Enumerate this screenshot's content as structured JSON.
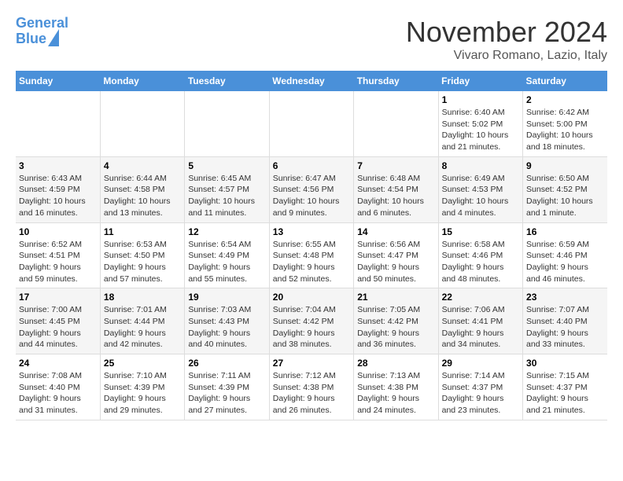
{
  "header": {
    "logo_line1": "General",
    "logo_line2": "Blue",
    "month_title": "November 2024",
    "location": "Vivaro Romano, Lazio, Italy"
  },
  "days_of_week": [
    "Sunday",
    "Monday",
    "Tuesday",
    "Wednesday",
    "Thursday",
    "Friday",
    "Saturday"
  ],
  "weeks": [
    [
      {
        "day": "",
        "info": ""
      },
      {
        "day": "",
        "info": ""
      },
      {
        "day": "",
        "info": ""
      },
      {
        "day": "",
        "info": ""
      },
      {
        "day": "",
        "info": ""
      },
      {
        "day": "1",
        "info": "Sunrise: 6:40 AM\nSunset: 5:02 PM\nDaylight: 10 hours and 21 minutes."
      },
      {
        "day": "2",
        "info": "Sunrise: 6:42 AM\nSunset: 5:00 PM\nDaylight: 10 hours and 18 minutes."
      }
    ],
    [
      {
        "day": "3",
        "info": "Sunrise: 6:43 AM\nSunset: 4:59 PM\nDaylight: 10 hours and 16 minutes."
      },
      {
        "day": "4",
        "info": "Sunrise: 6:44 AM\nSunset: 4:58 PM\nDaylight: 10 hours and 13 minutes."
      },
      {
        "day": "5",
        "info": "Sunrise: 6:45 AM\nSunset: 4:57 PM\nDaylight: 10 hours and 11 minutes."
      },
      {
        "day": "6",
        "info": "Sunrise: 6:47 AM\nSunset: 4:56 PM\nDaylight: 10 hours and 9 minutes."
      },
      {
        "day": "7",
        "info": "Sunrise: 6:48 AM\nSunset: 4:54 PM\nDaylight: 10 hours and 6 minutes."
      },
      {
        "day": "8",
        "info": "Sunrise: 6:49 AM\nSunset: 4:53 PM\nDaylight: 10 hours and 4 minutes."
      },
      {
        "day": "9",
        "info": "Sunrise: 6:50 AM\nSunset: 4:52 PM\nDaylight: 10 hours and 1 minute."
      }
    ],
    [
      {
        "day": "10",
        "info": "Sunrise: 6:52 AM\nSunset: 4:51 PM\nDaylight: 9 hours and 59 minutes."
      },
      {
        "day": "11",
        "info": "Sunrise: 6:53 AM\nSunset: 4:50 PM\nDaylight: 9 hours and 57 minutes."
      },
      {
        "day": "12",
        "info": "Sunrise: 6:54 AM\nSunset: 4:49 PM\nDaylight: 9 hours and 55 minutes."
      },
      {
        "day": "13",
        "info": "Sunrise: 6:55 AM\nSunset: 4:48 PM\nDaylight: 9 hours and 52 minutes."
      },
      {
        "day": "14",
        "info": "Sunrise: 6:56 AM\nSunset: 4:47 PM\nDaylight: 9 hours and 50 minutes."
      },
      {
        "day": "15",
        "info": "Sunrise: 6:58 AM\nSunset: 4:46 PM\nDaylight: 9 hours and 48 minutes."
      },
      {
        "day": "16",
        "info": "Sunrise: 6:59 AM\nSunset: 4:46 PM\nDaylight: 9 hours and 46 minutes."
      }
    ],
    [
      {
        "day": "17",
        "info": "Sunrise: 7:00 AM\nSunset: 4:45 PM\nDaylight: 9 hours and 44 minutes."
      },
      {
        "day": "18",
        "info": "Sunrise: 7:01 AM\nSunset: 4:44 PM\nDaylight: 9 hours and 42 minutes."
      },
      {
        "day": "19",
        "info": "Sunrise: 7:03 AM\nSunset: 4:43 PM\nDaylight: 9 hours and 40 minutes."
      },
      {
        "day": "20",
        "info": "Sunrise: 7:04 AM\nSunset: 4:42 PM\nDaylight: 9 hours and 38 minutes."
      },
      {
        "day": "21",
        "info": "Sunrise: 7:05 AM\nSunset: 4:42 PM\nDaylight: 9 hours and 36 minutes."
      },
      {
        "day": "22",
        "info": "Sunrise: 7:06 AM\nSunset: 4:41 PM\nDaylight: 9 hours and 34 minutes."
      },
      {
        "day": "23",
        "info": "Sunrise: 7:07 AM\nSunset: 4:40 PM\nDaylight: 9 hours and 33 minutes."
      }
    ],
    [
      {
        "day": "24",
        "info": "Sunrise: 7:08 AM\nSunset: 4:40 PM\nDaylight: 9 hours and 31 minutes."
      },
      {
        "day": "25",
        "info": "Sunrise: 7:10 AM\nSunset: 4:39 PM\nDaylight: 9 hours and 29 minutes."
      },
      {
        "day": "26",
        "info": "Sunrise: 7:11 AM\nSunset: 4:39 PM\nDaylight: 9 hours and 27 minutes."
      },
      {
        "day": "27",
        "info": "Sunrise: 7:12 AM\nSunset: 4:38 PM\nDaylight: 9 hours and 26 minutes."
      },
      {
        "day": "28",
        "info": "Sunrise: 7:13 AM\nSunset: 4:38 PM\nDaylight: 9 hours and 24 minutes."
      },
      {
        "day": "29",
        "info": "Sunrise: 7:14 AM\nSunset: 4:37 PM\nDaylight: 9 hours and 23 minutes."
      },
      {
        "day": "30",
        "info": "Sunrise: 7:15 AM\nSunset: 4:37 PM\nDaylight: 9 hours and 21 minutes."
      }
    ]
  ]
}
